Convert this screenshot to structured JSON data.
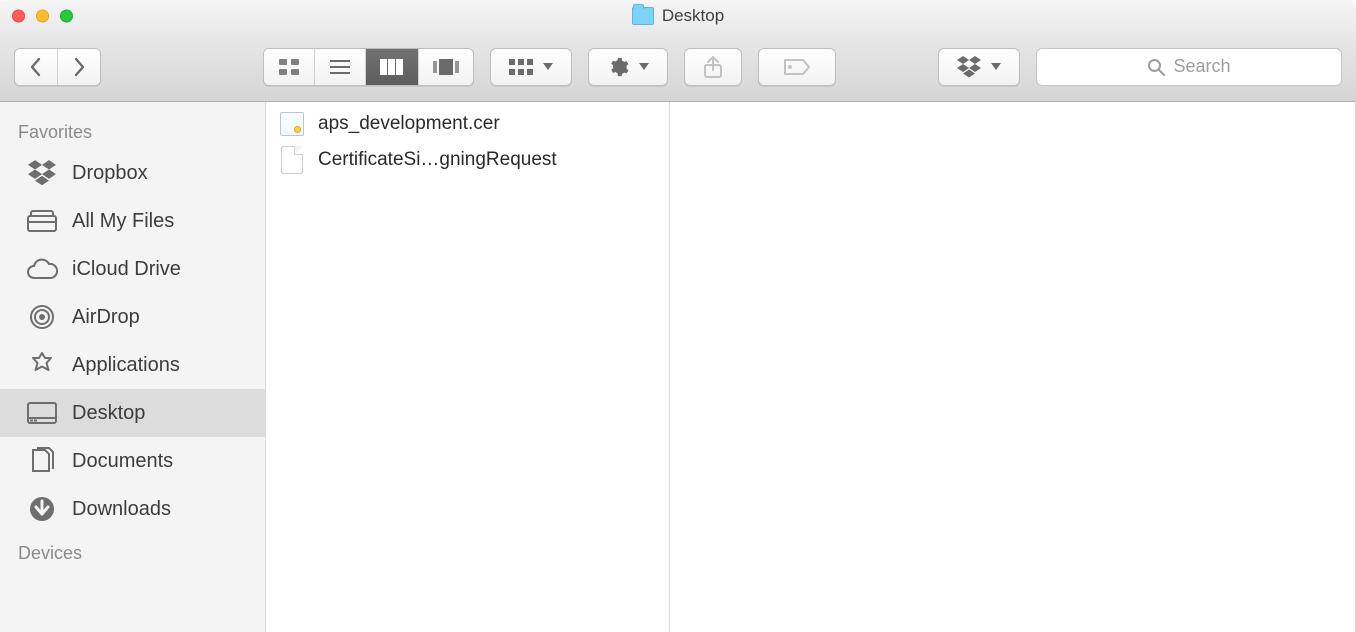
{
  "window": {
    "title": "Desktop"
  },
  "search": {
    "placeholder": "Search"
  },
  "sidebar": {
    "sections": [
      {
        "title": "Favorites",
        "items": [
          {
            "label": "Dropbox",
            "icon": "dropbox-icon",
            "selected": false
          },
          {
            "label": "All My Files",
            "icon": "allmyfiles-icon",
            "selected": false
          },
          {
            "label": "iCloud Drive",
            "icon": "icloud-icon",
            "selected": false
          },
          {
            "label": "AirDrop",
            "icon": "airdrop-icon",
            "selected": false
          },
          {
            "label": "Applications",
            "icon": "applications-icon",
            "selected": false
          },
          {
            "label": "Desktop",
            "icon": "desktop-icon",
            "selected": true
          },
          {
            "label": "Documents",
            "icon": "documents-icon",
            "selected": false
          },
          {
            "label": "Downloads",
            "icon": "downloads-icon",
            "selected": false
          }
        ]
      },
      {
        "title": "Devices",
        "items": []
      }
    ]
  },
  "files": [
    {
      "name": "aps_development.cer",
      "kind": "certificate"
    },
    {
      "name": "CertificateSi…gningRequest",
      "kind": "generic"
    }
  ]
}
